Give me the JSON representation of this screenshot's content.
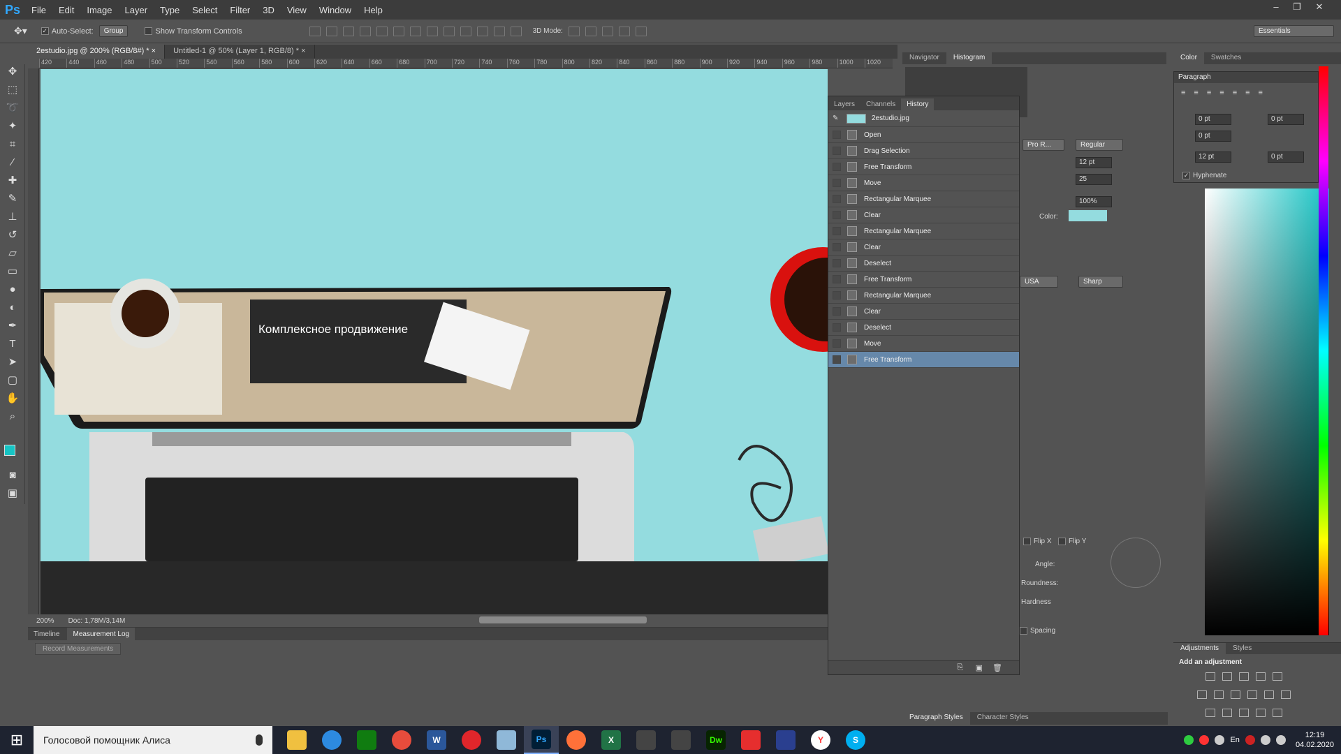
{
  "app": {
    "logo": "Ps"
  },
  "menu": [
    "File",
    "Edit",
    "Image",
    "Layer",
    "Type",
    "Select",
    "Filter",
    "3D",
    "View",
    "Window",
    "Help"
  ],
  "window_controls": [
    "–",
    "❐",
    "✕"
  ],
  "options": {
    "auto_select_label": "Auto-Select:",
    "auto_select_value": "Group",
    "show_transform_label": "Show Transform Controls",
    "mode_label": "3D Mode:",
    "workspace": "Essentials"
  },
  "tabs": [
    "2estudio.jpg @ 200% (RGB/8#) *",
    "Untitled-1 @ 50% (Layer 1, RGB/8) *"
  ],
  "ruler_labels": [
    "420",
    "440",
    "460",
    "480",
    "500",
    "520",
    "540",
    "560",
    "580",
    "600",
    "620",
    "640",
    "660",
    "680",
    "700",
    "720",
    "740",
    "760",
    "780",
    "800",
    "820",
    "840",
    "860",
    "880",
    "900",
    "920",
    "940",
    "960",
    "980",
    "1000",
    "1020"
  ],
  "status": {
    "zoom": "200%",
    "doc": "Doc: 1,78M/3,14M"
  },
  "bottom_panel": {
    "tabs": [
      "Timeline",
      "Measurement Log"
    ],
    "record": "Record Measurements"
  },
  "history": {
    "tabs": [
      "Layers",
      "Channels",
      "History"
    ],
    "snapshot": "2estudio.jpg",
    "items": [
      "Open",
      "Drag Selection",
      "Free Transform",
      "Move",
      "Rectangular Marquee",
      "Clear",
      "Rectangular Marquee",
      "Clear",
      "Deselect",
      "Free Transform",
      "Rectangular Marquee",
      "Clear",
      "Deselect",
      "Move",
      "Free Transform"
    ],
    "selected_index": 14
  },
  "navigator": {
    "tabs": [
      "Navigator",
      "Histogram"
    ]
  },
  "character": {
    "font_style": "Regular",
    "font_name": "Pro R...",
    "size": "12 pt",
    "tracking": "25",
    "scale": "100%",
    "color_label": "Color:",
    "lang": "USA",
    "aa": "Sharp"
  },
  "paragraph": {
    "title": "Paragraph",
    "indent_left": "0 pt",
    "indent_right": "0 pt",
    "indent_first": "0 pt",
    "space_before": "12 pt",
    "space_after": "0 pt",
    "hyphenate": "Hyphenate"
  },
  "color_panel": {
    "tabs": [
      "Color",
      "Swatches"
    ]
  },
  "brush": {
    "flip_x": "Flip X",
    "flip_y": "Flip Y",
    "angle": "Angle:",
    "roundness": "Roundness:",
    "hardness": "Hardness",
    "spacing": "Spacing"
  },
  "adjustments": {
    "tabs": [
      "Adjustments",
      "Styles"
    ],
    "add": "Add an adjustment"
  },
  "para_styles": [
    "Paragraph Styles",
    "Character Styles"
  ],
  "canvas": {
    "screen_title": "Комплексное продвижение"
  },
  "taskbar": {
    "search": "Голосовой помощник Алиса",
    "time": "12:19",
    "date": "04.02.2020",
    "lang": "En"
  },
  "colors": {
    "accent": "#31a8ff",
    "canvas_bg": "#94dcdf",
    "selection": "#6688aa",
    "fg_swatch": "#16c4c4"
  }
}
